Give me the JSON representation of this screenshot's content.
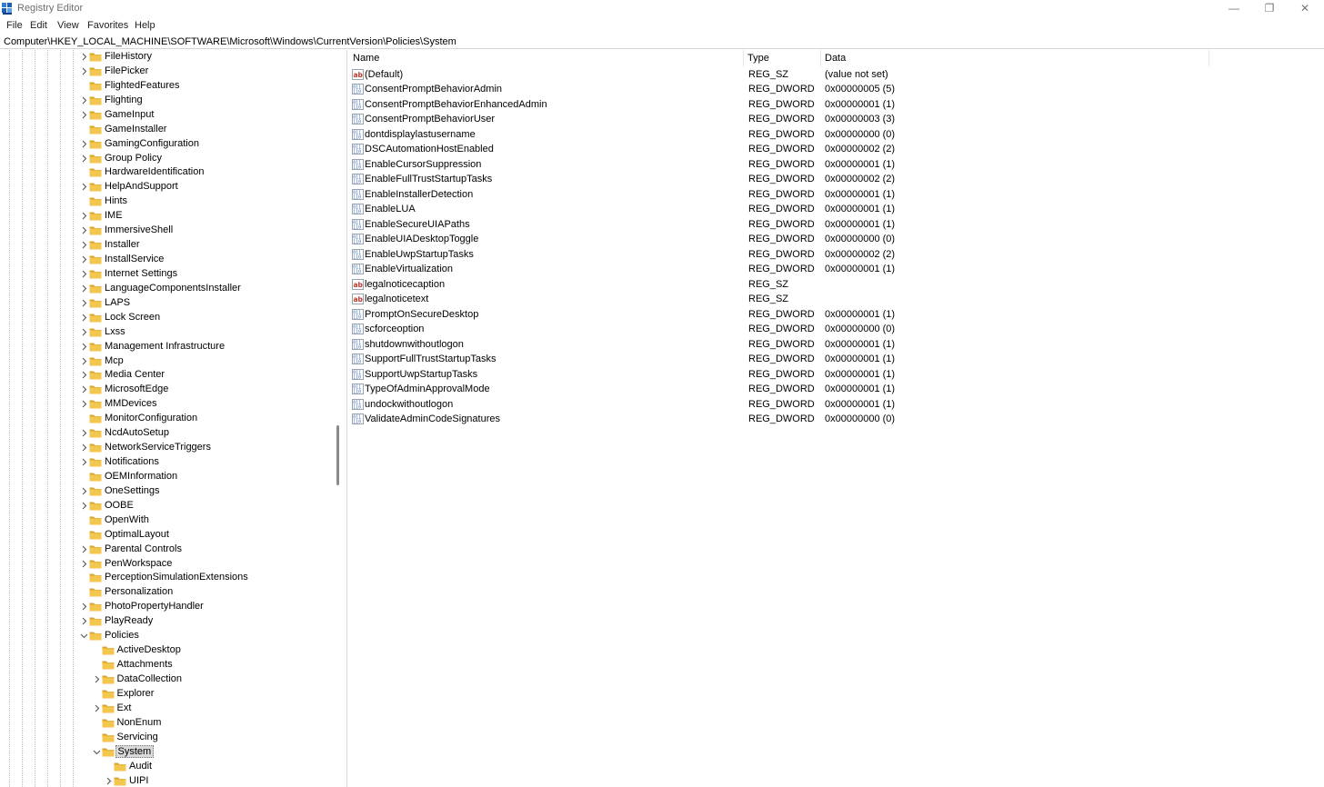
{
  "window": {
    "title": "Registry Editor",
    "minimize_glyph": "—",
    "maximize_glyph": "❐",
    "close_glyph": "✕"
  },
  "menu": [
    "File",
    "Edit",
    "View",
    "Favorites",
    "Help"
  ],
  "address": "Computer\\HKEY_LOCAL_MACHINE\\SOFTWARE\\Microsoft\\Windows\\CurrentVersion\\Policies\\System",
  "colors": {
    "folder": "#f3c64f",
    "folder_dark": "#dba628",
    "selection": "#d9d9d9",
    "reg_icon_blue": "#3a6fb0",
    "reg_sz_red": "#c0392b"
  },
  "tree": [
    {
      "label": "FileHistory",
      "level": 0,
      "chevron": "right"
    },
    {
      "label": "FilePicker",
      "level": 0,
      "chevron": "right"
    },
    {
      "label": "FlightedFeatures",
      "level": 0,
      "chevron": "none"
    },
    {
      "label": "Flighting",
      "level": 0,
      "chevron": "right"
    },
    {
      "label": "GameInput",
      "level": 0,
      "chevron": "right"
    },
    {
      "label": "GameInstaller",
      "level": 0,
      "chevron": "none"
    },
    {
      "label": "GamingConfiguration",
      "level": 0,
      "chevron": "right"
    },
    {
      "label": "Group Policy",
      "level": 0,
      "chevron": "right"
    },
    {
      "label": "HardwareIdentification",
      "level": 0,
      "chevron": "none"
    },
    {
      "label": "HelpAndSupport",
      "level": 0,
      "chevron": "right"
    },
    {
      "label": "Hints",
      "level": 0,
      "chevron": "none"
    },
    {
      "label": "IME",
      "level": 0,
      "chevron": "right"
    },
    {
      "label": "ImmersiveShell",
      "level": 0,
      "chevron": "right"
    },
    {
      "label": "Installer",
      "level": 0,
      "chevron": "right"
    },
    {
      "label": "InstallService",
      "level": 0,
      "chevron": "right"
    },
    {
      "label": "Internet Settings",
      "level": 0,
      "chevron": "right"
    },
    {
      "label": "LanguageComponentsInstaller",
      "level": 0,
      "chevron": "right"
    },
    {
      "label": "LAPS",
      "level": 0,
      "chevron": "right"
    },
    {
      "label": "Lock Screen",
      "level": 0,
      "chevron": "right"
    },
    {
      "label": "Lxss",
      "level": 0,
      "chevron": "right"
    },
    {
      "label": "Management Infrastructure",
      "level": 0,
      "chevron": "right"
    },
    {
      "label": "Mcp",
      "level": 0,
      "chevron": "right"
    },
    {
      "label": "Media Center",
      "level": 0,
      "chevron": "right"
    },
    {
      "label": "MicrosoftEdge",
      "level": 0,
      "chevron": "right"
    },
    {
      "label": "MMDevices",
      "level": 0,
      "chevron": "right"
    },
    {
      "label": "MonitorConfiguration",
      "level": 0,
      "chevron": "none"
    },
    {
      "label": "NcdAutoSetup",
      "level": 0,
      "chevron": "right"
    },
    {
      "label": "NetworkServiceTriggers",
      "level": 0,
      "chevron": "right"
    },
    {
      "label": "Notifications",
      "level": 0,
      "chevron": "right"
    },
    {
      "label": "OEMInformation",
      "level": 0,
      "chevron": "none"
    },
    {
      "label": "OneSettings",
      "level": 0,
      "chevron": "right"
    },
    {
      "label": "OOBE",
      "level": 0,
      "chevron": "right"
    },
    {
      "label": "OpenWith",
      "level": 0,
      "chevron": "none"
    },
    {
      "label": "OptimalLayout",
      "level": 0,
      "chevron": "none"
    },
    {
      "label": "Parental Controls",
      "level": 0,
      "chevron": "right"
    },
    {
      "label": "PenWorkspace",
      "level": 0,
      "chevron": "right"
    },
    {
      "label": "PerceptionSimulationExtensions",
      "level": 0,
      "chevron": "none"
    },
    {
      "label": "Personalization",
      "level": 0,
      "chevron": "none"
    },
    {
      "label": "PhotoPropertyHandler",
      "level": 0,
      "chevron": "right"
    },
    {
      "label": "PlayReady",
      "level": 0,
      "chevron": "right"
    },
    {
      "label": "Policies",
      "level": 0,
      "chevron": "down"
    },
    {
      "label": "ActiveDesktop",
      "level": 1,
      "chevron": "none"
    },
    {
      "label": "Attachments",
      "level": 1,
      "chevron": "none"
    },
    {
      "label": "DataCollection",
      "level": 1,
      "chevron": "right"
    },
    {
      "label": "Explorer",
      "level": 1,
      "chevron": "none"
    },
    {
      "label": "Ext",
      "level": 1,
      "chevron": "right"
    },
    {
      "label": "NonEnum",
      "level": 1,
      "chevron": "none"
    },
    {
      "label": "Servicing",
      "level": 1,
      "chevron": "none"
    },
    {
      "label": "System",
      "level": 1,
      "chevron": "down",
      "selected": true
    },
    {
      "label": "Audit",
      "level": 2,
      "chevron": "none"
    },
    {
      "label": "UIPI",
      "level": 2,
      "chevron": "right"
    }
  ],
  "columns": {
    "name": "Name",
    "type": "Type",
    "data": "Data"
  },
  "values": [
    {
      "name": "(Default)",
      "type": "REG_SZ",
      "data": "(value not set)",
      "icon": "string-value-icon"
    },
    {
      "name": "ConsentPromptBehaviorAdmin",
      "type": "REG_DWORD",
      "data": "0x00000005 (5)",
      "icon": "binary-value-icon"
    },
    {
      "name": "ConsentPromptBehaviorEnhancedAdmin",
      "type": "REG_DWORD",
      "data": "0x00000001 (1)",
      "icon": "binary-value-icon"
    },
    {
      "name": "ConsentPromptBehaviorUser",
      "type": "REG_DWORD",
      "data": "0x00000003 (3)",
      "icon": "binary-value-icon"
    },
    {
      "name": "dontdisplaylastusername",
      "type": "REG_DWORD",
      "data": "0x00000000 (0)",
      "icon": "binary-value-icon"
    },
    {
      "name": "DSCAutomationHostEnabled",
      "type": "REG_DWORD",
      "data": "0x00000002 (2)",
      "icon": "binary-value-icon"
    },
    {
      "name": "EnableCursorSuppression",
      "type": "REG_DWORD",
      "data": "0x00000001 (1)",
      "icon": "binary-value-icon"
    },
    {
      "name": "EnableFullTrustStartupTasks",
      "type": "REG_DWORD",
      "data": "0x00000002 (2)",
      "icon": "binary-value-icon"
    },
    {
      "name": "EnableInstallerDetection",
      "type": "REG_DWORD",
      "data": "0x00000001 (1)",
      "icon": "binary-value-icon"
    },
    {
      "name": "EnableLUA",
      "type": "REG_DWORD",
      "data": "0x00000001 (1)",
      "icon": "binary-value-icon"
    },
    {
      "name": "EnableSecureUIAPaths",
      "type": "REG_DWORD",
      "data": "0x00000001 (1)",
      "icon": "binary-value-icon"
    },
    {
      "name": "EnableUIADesktopToggle",
      "type": "REG_DWORD",
      "data": "0x00000000 (0)",
      "icon": "binary-value-icon"
    },
    {
      "name": "EnableUwpStartupTasks",
      "type": "REG_DWORD",
      "data": "0x00000002 (2)",
      "icon": "binary-value-icon"
    },
    {
      "name": "EnableVirtualization",
      "type": "REG_DWORD",
      "data": "0x00000001 (1)",
      "icon": "binary-value-icon"
    },
    {
      "name": "legalnoticecaption",
      "type": "REG_SZ",
      "data": "",
      "icon": "string-value-icon"
    },
    {
      "name": "legalnoticetext",
      "type": "REG_SZ",
      "data": "",
      "icon": "string-value-icon"
    },
    {
      "name": "PromptOnSecureDesktop",
      "type": "REG_DWORD",
      "data": "0x00000001 (1)",
      "icon": "binary-value-icon"
    },
    {
      "name": "scforceoption",
      "type": "REG_DWORD",
      "data": "0x00000000 (0)",
      "icon": "binary-value-icon"
    },
    {
      "name": "shutdownwithoutlogon",
      "type": "REG_DWORD",
      "data": "0x00000001 (1)",
      "icon": "binary-value-icon"
    },
    {
      "name": "SupportFullTrustStartupTasks",
      "type": "REG_DWORD",
      "data": "0x00000001 (1)",
      "icon": "binary-value-icon"
    },
    {
      "name": "SupportUwpStartupTasks",
      "type": "REG_DWORD",
      "data": "0x00000001 (1)",
      "icon": "binary-value-icon"
    },
    {
      "name": "TypeOfAdminApprovalMode",
      "type": "REG_DWORD",
      "data": "0x00000001 (1)",
      "icon": "binary-value-icon"
    },
    {
      "name": "undockwithoutlogon",
      "type": "REG_DWORD",
      "data": "0x00000001 (1)",
      "icon": "binary-value-icon"
    },
    {
      "name": "ValidateAdminCodeSignatures",
      "type": "REG_DWORD",
      "data": "0x00000000 (0)",
      "icon": "binary-value-icon"
    }
  ]
}
